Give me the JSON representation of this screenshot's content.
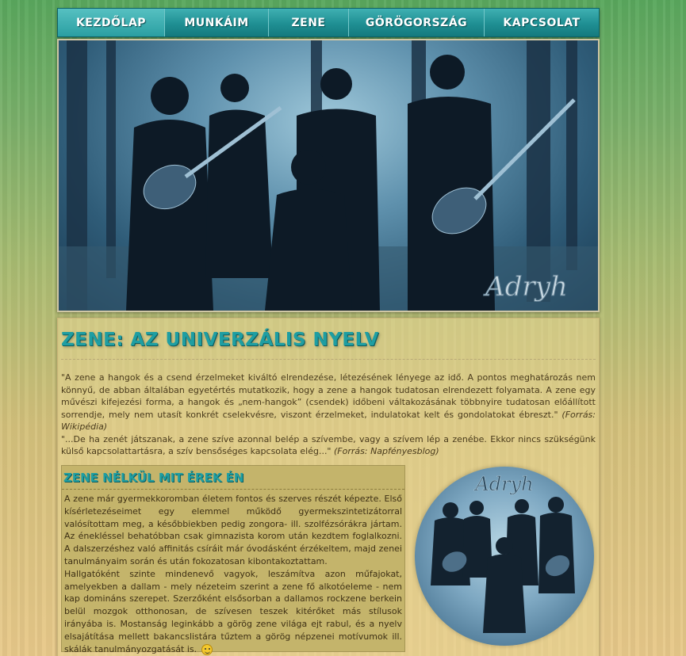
{
  "nav": {
    "items": [
      {
        "label": "KEZDŐLAP",
        "active": true
      },
      {
        "label": "MUNKÁIM",
        "active": false
      },
      {
        "label": "ZENE",
        "active": false
      },
      {
        "label": "GÖRÖGORSZÁG",
        "active": false
      },
      {
        "label": "KAPCSOLAT",
        "active": false
      }
    ]
  },
  "hero": {
    "logo_text": "Adryh"
  },
  "main": {
    "title": "ZENE: AZ UNIVERZÁLIS NYELV",
    "quote1": "\"A zene a hangok és a csend érzelmeket kiváltó elrendezése, létezésének lényege az idő. A pontos meghatározás nem könnyű, de abban általában egyetértés mutatkozik, hogy a zene a hangok tudatosan elrendezett folyamata. A zene egy művészi kifejezési forma, a hangok és „nem-hangok” (csendek) időbeni váltakozásának többnyire tudatosan előállított sorrendje, mely nem utasít konkrét cselekvésre, viszont érzelmeket, indulatokat kelt és gondolatokat ébreszt.\"",
    "quote1_source": "(Forrás: Wikipédia)",
    "quote2": "\"...De ha zenét játszanak, a zene szíve azonnal belép a szívembe, vagy a szívem lép a zenébe. Ekkor nincs szükségünk külső kapcsolattartásra, a szív bensőséges kapcsolata elég...\"",
    "quote2_source": "(Forrás: Napfényesblog)"
  },
  "section": {
    "title": "ZENE NÉLKÜL MIT ÉREK ÉN",
    "paragraph1": "A zene már gyermekkoromban életem fontos és szerves részét képezte. Első kísérletezéseimet egy elemmel működő gyermekszintetizátorral valósítottam meg, a későbbiekben pedig zongora- ill. szolfézsórákra jártam. Az énekléssel behatóbban csak gimnazista korom után kezdtem foglalkozni. A dalszerzéshez való affinitás csíráit már óvodásként érzékeltem, majd zenei tanulmányaim során és után fokozatosan kibontakoztattam.",
    "paragraph2": "Hallgatóként szinte mindenevő vagyok, leszámítva azon műfajokat, amelyekben a dallam - mely nézeteim szerint a zene fő alkotóeleme - nem kap domináns szerepet. Szerzőként elsősorban a dallamos rockzene berkein belül mozgok otthonosan, de szívesen teszek kitérőket más stílusok irányába is. Mostanság leginkább a görög zene világa ejt rabul, és a nyelv elsajátítása mellett bakancslistára tűztem a görög népzenei motívumok ill. skálák tanulmányozgatását is."
  },
  "circle_logo_text": "Adryh"
}
